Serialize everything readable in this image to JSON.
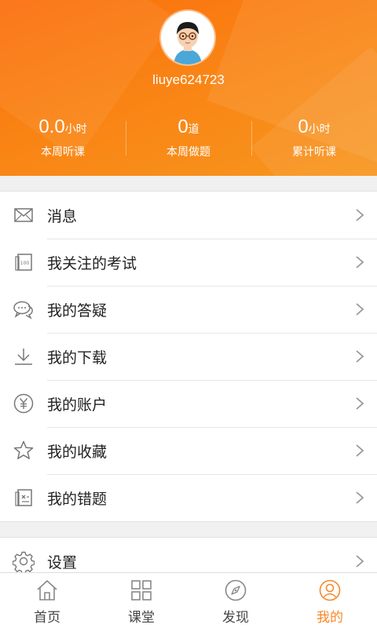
{
  "profile": {
    "username": "liuye624723"
  },
  "stats": [
    {
      "value": "0.0",
      "unit": "小时",
      "label": "本周听课"
    },
    {
      "value": "0",
      "unit": "道",
      "label": "本周做题"
    },
    {
      "value": "0",
      "unit": "小时",
      "label": "累计听课"
    }
  ],
  "menu": {
    "items": [
      {
        "label": "消息",
        "icon": "mail-icon"
      },
      {
        "label": "我关注的考试",
        "icon": "exam-book-icon"
      },
      {
        "label": "我的答疑",
        "icon": "chat-bubbles-icon"
      },
      {
        "label": "我的下载",
        "icon": "download-icon"
      },
      {
        "label": "我的账户",
        "icon": "yuan-coin-icon"
      },
      {
        "label": "我的收藏",
        "icon": "star-icon"
      },
      {
        "label": "我的错题",
        "icon": "wrong-questions-icon"
      }
    ],
    "settings_label": "设置"
  },
  "tabbar": {
    "tabs": [
      {
        "label": "首页",
        "icon": "home-icon",
        "active": false
      },
      {
        "label": "课堂",
        "icon": "grid-icon",
        "active": false
      },
      {
        "label": "发现",
        "icon": "compass-icon",
        "active": false
      },
      {
        "label": "我的",
        "icon": "user-circle-icon",
        "active": true
      }
    ]
  },
  "colors": {
    "header_orange": "#fb7a12",
    "active_tab": "#f7882a",
    "icon_gray": "#777777"
  }
}
